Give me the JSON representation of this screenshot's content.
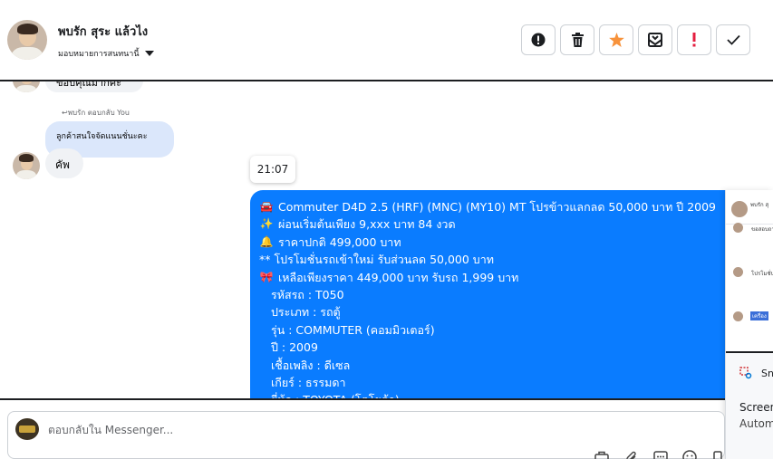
{
  "header": {
    "contact_name": "พบรัก สุระ แล้วไง",
    "assign_label": "มอบหมายการสนทนานี้",
    "toolbar": {
      "report_icon": "exclamation-circle-icon",
      "delete_icon": "trash-icon",
      "star_icon": "star-icon",
      "archive_icon": "envelope-archive-icon",
      "important_icon": "exclamation-mark-icon",
      "done_icon": "checkmark-icon"
    }
  },
  "messages": {
    "partial_top": "ขอบคุณมากค่ะ",
    "reply_note": "พบรัก ตอบกลับ You",
    "reply_quote": "ลูกค้าสนใจจัดแนนชั่นะคะ",
    "incoming": "คัพ",
    "timestamp": "21:07",
    "outgoing_lines": [
      {
        "emoji": "🚘",
        "text": "Commuter D4D 2.5 (HRF) (MNC) (MY10) MT โปรข้าวแลกลด 50,000 บาท ปี 2009"
      },
      {
        "emoji": "✨",
        "text": "ผ่อนเริ่มต้นเพียง 9,xxx บาท  84 งวด"
      },
      {
        "emoji": "🔔",
        "text": "ราคาปกติ 499,000 บาท"
      },
      {
        "emoji": "",
        "text": "** โปรโมชั่นรถเข้าใหม่ รับส่วนลด 50,000 บาท"
      },
      {
        "emoji": "🎀",
        "text": "เหลือเพียงราคา 449,000 บาท รับรถ 1,999 บาท"
      },
      {
        "emoji": "",
        "text": "รหัสรถ : T050"
      },
      {
        "emoji": "",
        "text": "ประเภท : รถตู้"
      },
      {
        "emoji": "",
        "text": "รุ่น : COMMUTER (คอมมิวเตอร์)"
      },
      {
        "emoji": "",
        "text": "ปี : 2009"
      },
      {
        "emoji": "",
        "text": "เชื้อเพลิง : ดีเซล"
      },
      {
        "emoji": "",
        "text": "เกียร์ : ธรรมดา"
      },
      {
        "emoji": "",
        "text": "ยี่ห้อ : TOYOTA (โตโยต้า)"
      }
    ]
  },
  "panel": {
    "header_name": "พบรัก สุ",
    "items": [
      "ขอสอบถา",
      "โปรโมชั่นลด",
      "เครื่อง"
    ],
    "snip_label": "Sni",
    "screen_label": "Screen",
    "auto_label": "Autom"
  },
  "composer": {
    "placeholder": "ตอบกลับใน Messenger..."
  },
  "colors": {
    "accent": "#0a7cff",
    "star": "#f7923b",
    "important": "#e41e3f"
  }
}
